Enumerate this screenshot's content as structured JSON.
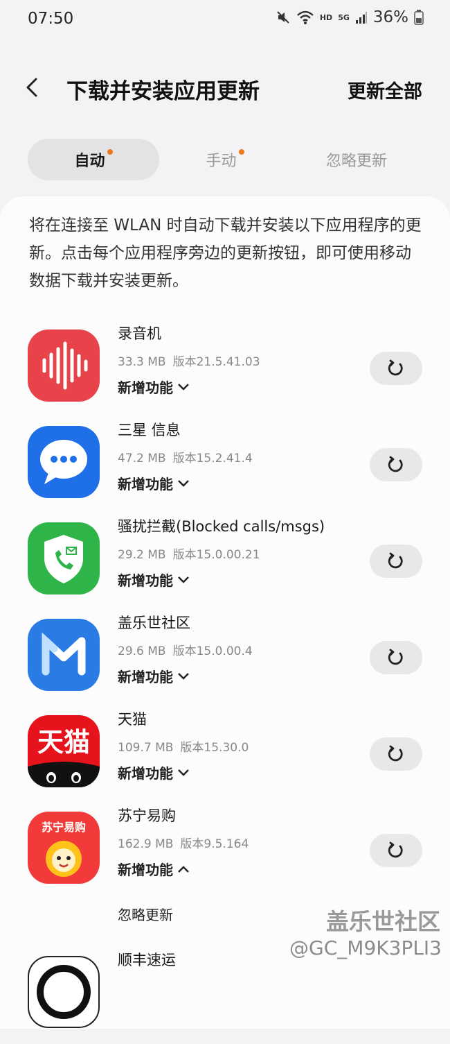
{
  "status_bar": {
    "time": "07:50",
    "network_label": "HD",
    "signal_label": "5G",
    "battery": "36%"
  },
  "header": {
    "title": "下载并安装应用更新",
    "action": "更新全部"
  },
  "tabs": [
    {
      "label": "自动",
      "active": true,
      "dot": true
    },
    {
      "label": "手动",
      "active": false,
      "dot": true
    },
    {
      "label": "忽略更新",
      "active": false,
      "dot": false
    }
  ],
  "description": "将在连接至 WLAN 时自动下载并安装以下应用程序的更新。点击每个应用程序旁边的更新按钮，即可使用移动数据下载并安装更新。",
  "apps": [
    {
      "name": "录音机",
      "size": "33.3 MB",
      "version": "版本21.5.41.03",
      "whatsnew": "新增功能",
      "icon": "voice-recorder-icon"
    },
    {
      "name": "三星 信息",
      "size": "47.2 MB",
      "version": "版本15.2.41.4",
      "whatsnew": "新增功能",
      "icon": "messages-icon"
    },
    {
      "name": "骚扰拦截(Blocked calls/msgs)",
      "size": "29.2 MB",
      "version": "版本15.0.00.21",
      "whatsnew": "新增功能",
      "icon": "call-block-icon"
    },
    {
      "name": "盖乐世社区",
      "size": "29.6 MB",
      "version": "版本15.0.00.4",
      "whatsnew": "新增功能",
      "icon": "members-icon"
    },
    {
      "name": "天猫",
      "size": "109.7 MB",
      "version": "版本15.30.0",
      "whatsnew": "新增功能",
      "icon": "tmall-icon",
      "icon_text": "天猫"
    },
    {
      "name": "苏宁易购",
      "size": "162.9 MB",
      "version": "版本9.5.164",
      "whatsnew": "新增功能",
      "icon": "suning-icon",
      "icon_text": "苏宁易购",
      "expanded": true
    },
    {
      "name": "顺丰速运",
      "icon": "sf-express-icon"
    }
  ],
  "ignore_update": "忽略更新",
  "watermark": {
    "title": "盖乐世社区",
    "user": "@GC_M9K3PLI3"
  },
  "colors": {
    "dot": "#f07a1a",
    "background": "#f3f3f5",
    "card": "#fcfcfc"
  }
}
